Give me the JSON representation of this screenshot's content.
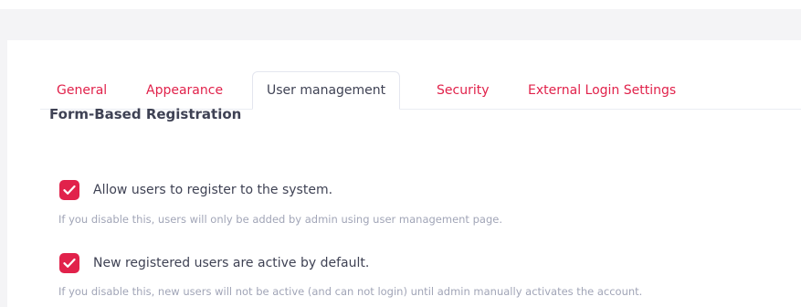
{
  "tabs": [
    {
      "label": "General",
      "active": false
    },
    {
      "label": "Appearance",
      "active": false
    },
    {
      "label": "User management",
      "active": true
    },
    {
      "label": "Security",
      "active": false
    },
    {
      "label": "External Login Settings",
      "active": false
    }
  ],
  "section": {
    "title": "Form-Based Registration",
    "options": [
      {
        "label": "Allow users to register to the system.",
        "hint": "If you disable this, users will only be added by admin using user management page.",
        "checked": true
      },
      {
        "label": "New registered users are active by default.",
        "hint": "If you disable this, new users will not be active (and can not login) until admin manually activates the account.",
        "checked": true
      }
    ]
  },
  "colors": {
    "accent": "#e1224b",
    "text": "#3f4254",
    "muted": "#a1a5b7",
    "background": "#f4f4f6"
  }
}
